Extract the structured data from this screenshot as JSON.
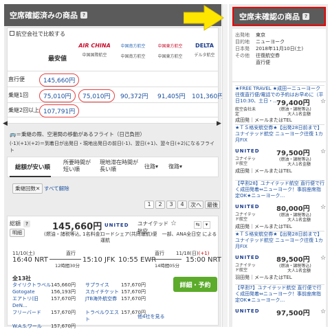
{
  "left": {
    "title": "空席確認済みの商品",
    "compare_label": "航空会社で比較する",
    "cheapest_header": "最安値",
    "airlines": [
      {
        "logo": "AIR CHINA",
        "name": "中国国際航空"
      },
      {
        "logo": "中国南方航空",
        "name": "中国南方航空"
      },
      {
        "logo": "中国東方航空",
        "name": "中国東方航空"
      },
      {
        "logo": "DELTA",
        "name": "デルタ航空"
      }
    ],
    "rows": [
      {
        "label": "直行便",
        "cheapest": "145,660円",
        "cells": [
          "",
          "",
          "",
          ""
        ]
      },
      {
        "label": "乗継1回",
        "cheapest": "75,010円",
        "cells": [
          "75,010円",
          "90,372円",
          "91,405円",
          "101,360円"
        ]
      },
      {
        "label": "乗継2回以上",
        "cheapest": "107,791円",
        "cells": [
          "",
          "",
          "",
          ""
        ]
      }
    ],
    "note1": "＝乗継の際、空港間の移動があるフライト（日己負担）",
    "note2": "(-1)(+1)(+2)＝到着日が出発日・現地出発日の前日(-1)、翌日(+1)、翌々日(+2)になるフライト",
    "sort_tabs": [
      "総額が安い順",
      "所要時間が短い順",
      "現地滞在時間が長い順",
      "往路",
      "復路"
    ],
    "filter_label": "乗継回数",
    "clear_label": "すべて解除",
    "pages": [
      "1",
      "2",
      "3",
      "4",
      "次へ",
      "最後"
    ],
    "result": {
      "total_label": "総額",
      "detail_label": "明細",
      "price": "145,660円",
      "price_note": "(燃油・諸税等込, 1名料金)",
      "airline_logo": "UNITED",
      "airline_name": "ユナイテッド航空",
      "codeshare": "コードシェア(共同運航)便　一部、ANA全日空 による運航",
      "out_date": "11/10(土)",
      "out_dep": "16:40 NRT",
      "out_type": "直行",
      "out_duration": "12時間30分",
      "out_arr": "15:10 JFK",
      "in_date": "11/18(日)",
      "in_date_mark": "(+1)",
      "in_dep": "10:55 EWR",
      "in_type": "直行",
      "in_duration": "14時間05分",
      "in_arr": "15:00 NRT",
      "companies_label": "全13社",
      "book_label": "詳細・予約",
      "more_label": "他4社を見る",
      "agencies": [
        {
          "name": "タイリクトラベル",
          "price": "145,660円"
        },
        {
          "name": "Gotogate",
          "price": "156,193円"
        },
        {
          "name": "エアトリ(旧DeN…",
          "price": "157,670円"
        },
        {
          "name": "フリーバード",
          "price": "157,670円"
        },
        {
          "name": "W.A.S.ワールド…",
          "price": "157,670円"
        },
        {
          "name": "サプライス",
          "price": "157,670円"
        },
        {
          "name": "スカイチケット",
          "price": "157,670円"
        },
        {
          "name": "JTB海外航空券",
          "price": "157,670円"
        },
        {
          "name": "トラベルウエスト",
          "price": "157,670円"
        }
      ]
    }
  },
  "right": {
    "title": "空席未確認の商品",
    "info": [
      {
        "key": "出発地",
        "value": "東京"
      },
      {
        "key": "目的地",
        "value": "ニューヨーク"
      },
      {
        "key": "日本発",
        "value": "2018年11月10日(土)"
      },
      {
        "key": "その他",
        "value": "往復航空券"
      },
      {
        "key": "",
        "value": "直行便"
      }
    ],
    "items": [
      {
        "desc": "★FREE TRAVEL ★成田ーニューヨーク往復直行便/電話での予約はお早めに（平日10:30、土日・…",
        "price": "79,400円",
        "agent": "航空会社未定",
        "agent2": "",
        "sub": "(燃油・諸税等込)",
        "pax": "大人1名金額",
        "airport": "成田発",
        "contact": "メールまたはTEL"
      },
      {
        "desc": "★ＴＳ格安航空券★【出発28日前まで】ユナイテッド航空 ニューヨーク往復 1カ月FIX",
        "price": "79,500円",
        "agent": "ユナイテッド航空",
        "agent2": "",
        "sub": "(燃油・諸税等込)",
        "pax": "大人1名金額",
        "airport": "成田発",
        "contact": "メールまたはTEL"
      },
      {
        "desc": "【早割28】ユナイテッド航空 直行便で行く成田発着⇔ニューヨーク！事前座席指定OK★ニューヨーク…",
        "price": "80,000円",
        "agent": "ユナイテッド航空",
        "agent2": "",
        "sub": "(燃油・諸税等込)",
        "pax": "大人1名金額",
        "airport": "成田発",
        "contact": "メールまたはTEL"
      },
      {
        "desc": "★ＴＳ格安航空券★【出発28日前まで】ユナイテッド航空 ニューヨーク往復 1カ月FIX",
        "price": "89,500円",
        "agent": "ユナイテッド航空",
        "agent2": "",
        "sub": "(燃油・諸税等込)",
        "pax": "大人1名金額",
        "airport": "羽田発",
        "contact": "メールまたはTEL"
      },
      {
        "desc": "【早割7】ユナイテッド航空 直行便で行く成田発着⇔ニューヨーク！事前座席指定OK★ニューヨーク…",
        "price": "97,500円",
        "agent": "",
        "agent2": "",
        "sub": "",
        "pax": "",
        "airport": "",
        "contact": ""
      }
    ]
  },
  "colors": {
    "header": "#5b5b5b",
    "accent_blue": "#1a4fa0",
    "circle_red": "#e74040",
    "book_green": "#5cab2b",
    "arrow_yellow": "#ffe600"
  }
}
